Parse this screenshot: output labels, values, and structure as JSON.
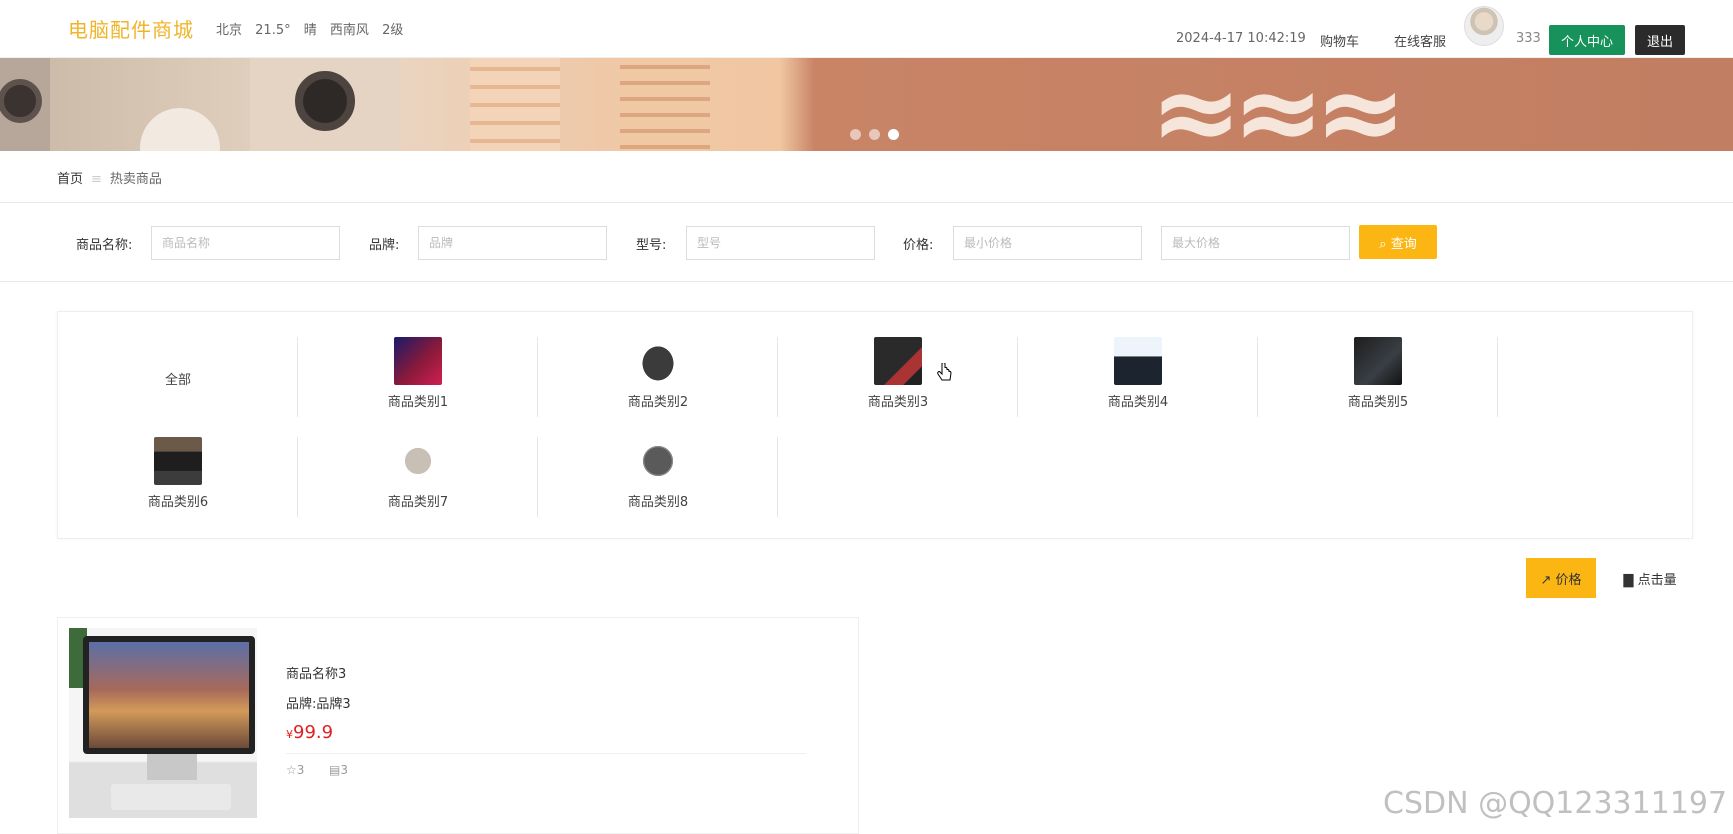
{
  "header": {
    "logo": "电脑配件商城",
    "weather": {
      "city": "北京",
      "temp": "21.5°",
      "condition": "晴",
      "wind": "西南风",
      "level": "2级"
    },
    "datetime": "2024-4-17 10:42:19",
    "cart": "购物车",
    "service": "在线客服",
    "username": "333",
    "center_btn": "个人中心",
    "logout_btn": "退出"
  },
  "banner": {
    "slides": 3,
    "active_slide": 3
  },
  "breadcrumb": {
    "home": "首页",
    "separator": "≡",
    "current": "热卖商品"
  },
  "search": {
    "name_label": "商品名称:",
    "name_placeholder": "商品名称",
    "brand_label": "品牌:",
    "brand_placeholder": "品牌",
    "model_label": "型号:",
    "model_placeholder": "型号",
    "price_label": "价格:",
    "min_placeholder": "最小价格",
    "max_placeholder": "最大价格",
    "button": "查询"
  },
  "categories": {
    "all": "全部",
    "items": [
      "商品类别1",
      "商品类别2",
      "商品类别3",
      "商品类别4",
      "商品类别5",
      "商品类别6",
      "商品类别7",
      "商品类别8"
    ]
  },
  "sort": {
    "price": "价格",
    "clicks": "点击量"
  },
  "products": [
    {
      "name": "商品名称3",
      "brand": "品牌:品牌3",
      "currency": "¥",
      "price": "99.9",
      "favorites": "3",
      "comments": "3"
    }
  ],
  "watermark": "CSDN @QQ123311197",
  "colors": {
    "accent": "#fbb614",
    "logo": "#f0b429",
    "center_btn": "#16925a",
    "price": "#e02020"
  }
}
